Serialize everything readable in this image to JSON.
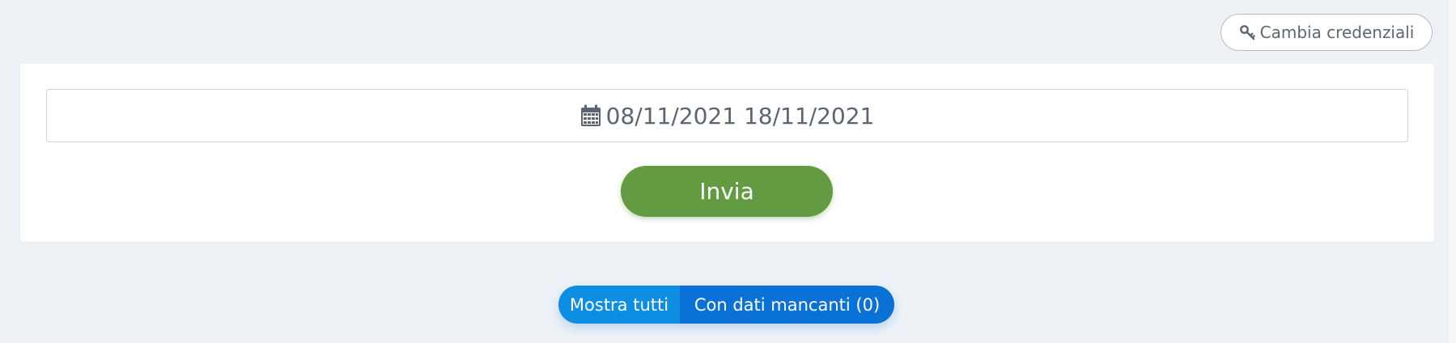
{
  "header": {
    "change_credentials_label": "Cambia credenziali",
    "change_credentials_icon": "key-icon"
  },
  "form": {
    "date_range_icon": "calendar-icon",
    "date_range_value": "08/11/2021 18/11/2021",
    "submit_label": "Invia",
    "submit_color": "#629b42"
  },
  "filters": {
    "show_all_label": "Mostra tutti",
    "missing_data_label": "Con dati mancanti (0)",
    "active": "Mostra tutti",
    "colors": {
      "active": "#0d8ee3",
      "inactive": "#0a72d6"
    }
  }
}
